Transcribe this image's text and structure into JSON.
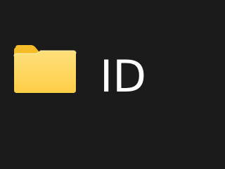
{
  "item": {
    "label": "ID",
    "icon": "folder-icon"
  },
  "colors": {
    "background": "#1b1b1b",
    "text": "#ffffff",
    "folder_front": "#ffd35c",
    "folder_back": "#f2b51f"
  }
}
